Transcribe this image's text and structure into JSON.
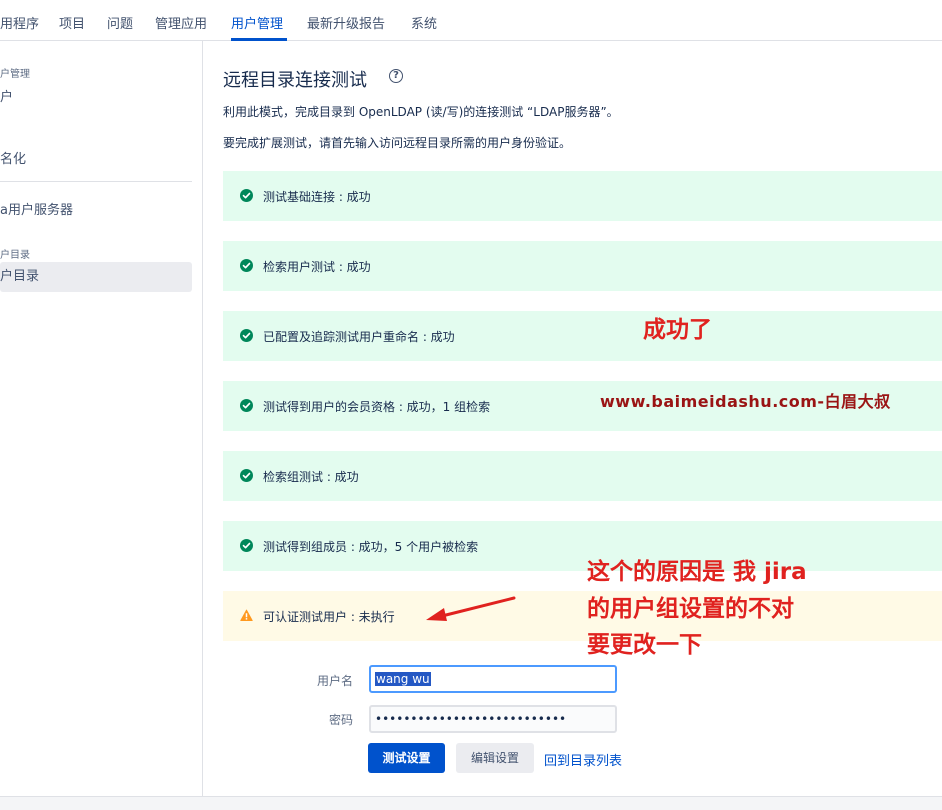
{
  "nav": {
    "tabs": [
      "用程序",
      "项目",
      "问题",
      "管理应用",
      "用户管理",
      "最新升级报告",
      "系统"
    ],
    "active": "用户管理"
  },
  "sidebar": {
    "group1": "户管理",
    "item1": "户",
    "item2": "名化",
    "item3": "a用户服务器",
    "group2": "户目录",
    "item4": "户目录"
  },
  "main": {
    "title": "远程目录连接测试",
    "help": "?",
    "desc1": "利用此模式，完成目录到 OpenLDAP (读/写)的连接测试 “LDAP服务器”。",
    "desc2": "要完成扩展测试，请首先输入访问远程目录所需的用户身份验证。",
    "results": [
      {
        "text": "测试基础连接 : 成功",
        "status": "success"
      },
      {
        "text": "检索用户测试 : 成功",
        "status": "success"
      },
      {
        "text": "已配置及追踪测试用户重命名 : 成功",
        "status": "success"
      },
      {
        "text": "测试得到用户的会员资格 : 成功，1 组检索",
        "status": "success"
      },
      {
        "text": "检索组测试 : 成功",
        "status": "success"
      },
      {
        "text": "测试得到组成员 : 成功，5 个用户被检索",
        "status": "success"
      },
      {
        "text": "可认证测试用户 : 未执行",
        "status": "warning"
      }
    ],
    "form": {
      "username_label": "用户名",
      "username_value": "wang wu",
      "password_label": "密码",
      "password_value": "•••••••••••••••••••••••••••"
    },
    "buttons": {
      "test": "测试设置",
      "edit": "编辑设置",
      "back": "回到目录列表"
    }
  },
  "annotations": {
    "success": "成功了",
    "watermark": "www.baimeidashu.com-白眉大叔",
    "reason_line1": "这个的原因是 我 jira",
    "reason_line2": "的用户组设置的不对",
    "reason_line3": "要更改一下"
  },
  "colors": {
    "accent": "#0052cc",
    "success_bg": "#e3fcef",
    "success_icon": "#00875a",
    "warning_bg": "#fffae6",
    "warning_icon": "#ff991f",
    "annotation_red": "#e0221f",
    "watermark_red": "#9a1414"
  }
}
